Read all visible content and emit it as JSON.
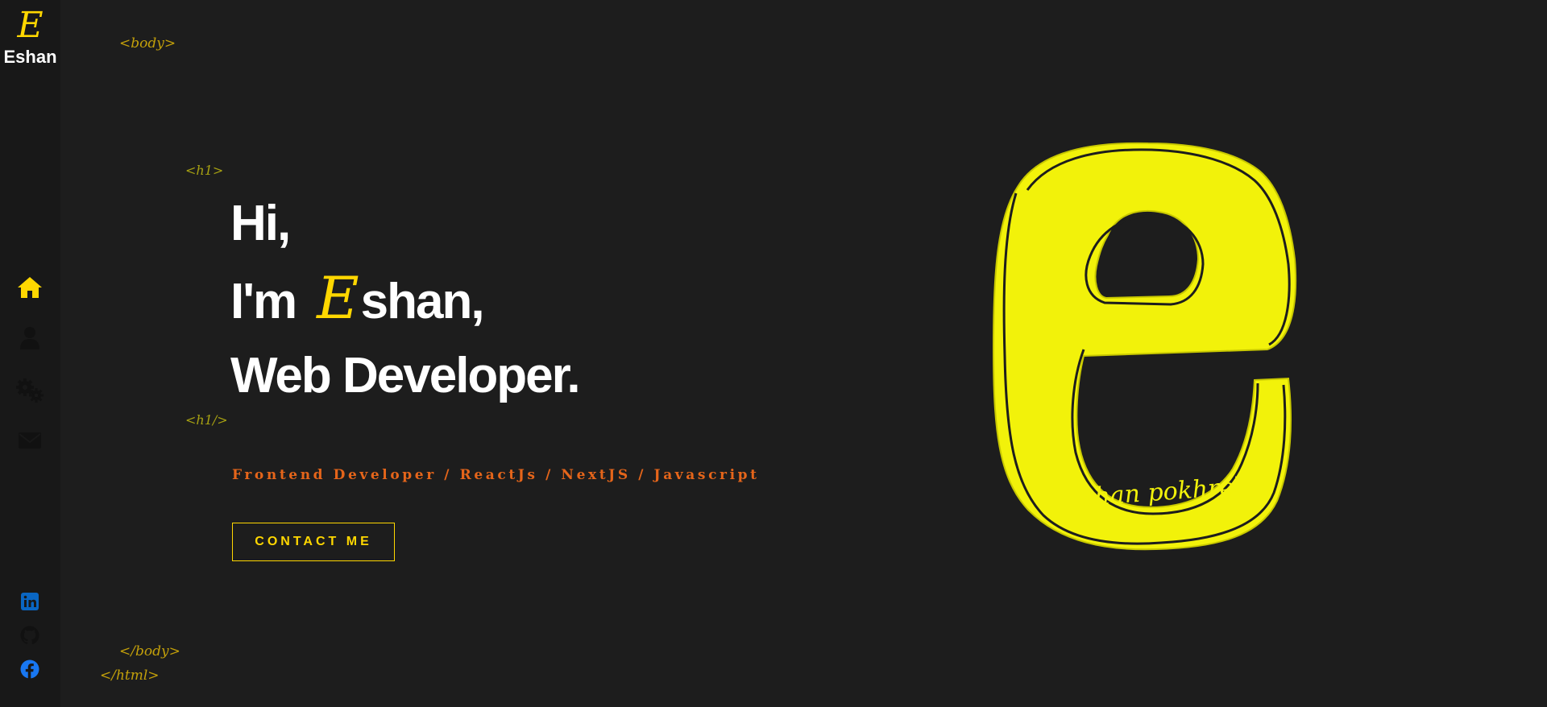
{
  "sidebar": {
    "logo_letter": "E",
    "logo_name": "Eshan",
    "nav": [
      {
        "icon": "home-icon",
        "active": true
      },
      {
        "icon": "user-icon",
        "active": false
      },
      {
        "icon": "gears-icon",
        "active": false
      },
      {
        "icon": "envelope-icon",
        "active": false
      }
    ],
    "social": [
      {
        "icon": "linkedin-icon",
        "color": "#0a66c2"
      },
      {
        "icon": "github-icon",
        "color": "#111111"
      },
      {
        "icon": "facebook-icon",
        "color": "#1877f2"
      }
    ]
  },
  "tags": {
    "body_open": "<body>",
    "h1_open": "<h1>",
    "h1_close": "<h1/>",
    "body_close": "</body>",
    "html_close": "</html>"
  },
  "hero": {
    "line1": "Hi,",
    "line2_prefix": "I'm",
    "line2_letter": "E",
    "line2_rest": "shan,",
    "line3": "Web Developer.",
    "subtitle": "Frontend Developer / ReactJs / NextJS / Javascript",
    "contact_label": "CONTACT ME",
    "signature": "shan pokhrel"
  },
  "colors": {
    "accent": "#ffd700",
    "logo_yellow": "#f2f20a",
    "subtitle_orange": "#e5651a",
    "background": "#1d1d1d",
    "sidebar": "#181818"
  }
}
